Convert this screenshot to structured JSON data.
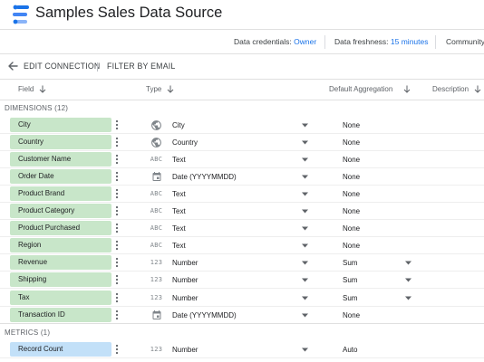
{
  "app": {
    "title": "Samples Sales Data Source"
  },
  "infobar": {
    "credentials_label": "Data credentials:",
    "credentials_value": "Owner",
    "freshness_label": "Data freshness:",
    "freshness_value": "15 minutes",
    "community_label": "Community"
  },
  "actions": {
    "edit_connection": "EDIT CONNECTION",
    "filter_by_email": "FILTER BY EMAIL"
  },
  "columns": {
    "field": "Field",
    "type": "Type",
    "default_aggregation": "Default Aggregation",
    "description": "Description"
  },
  "sections": {
    "dimensions": "DIMENSIONS (12)",
    "metrics": "METRICS (1)"
  },
  "dimensions": [
    {
      "name": "City",
      "icon": "globe-icon",
      "type": "City",
      "aggregation": "None"
    },
    {
      "name": "Country",
      "icon": "globe-icon",
      "type": "Country",
      "aggregation": "None"
    },
    {
      "name": "Customer Name",
      "icon": "text-type-icon",
      "icon_text": "ABC",
      "type": "Text",
      "aggregation": "None"
    },
    {
      "name": "Order Date",
      "icon": "calendar-icon",
      "type": "Date (YYYYMMDD)",
      "aggregation": "None"
    },
    {
      "name": "Product Brand",
      "icon": "text-type-icon",
      "icon_text": "ABC",
      "type": "Text",
      "aggregation": "None"
    },
    {
      "name": "Product Category",
      "icon": "text-type-icon",
      "icon_text": "ABC",
      "type": "Text",
      "aggregation": "None"
    },
    {
      "name": "Product Purchased",
      "icon": "text-type-icon",
      "icon_text": "ABC",
      "type": "Text",
      "aggregation": "None"
    },
    {
      "name": "Region",
      "icon": "text-type-icon",
      "icon_text": "ABC",
      "type": "Text",
      "aggregation": "None"
    },
    {
      "name": "Revenue",
      "icon": "number-type-icon",
      "icon_text": "123",
      "type": "Number",
      "aggregation": "Sum"
    },
    {
      "name": "Shipping",
      "icon": "number-type-icon",
      "icon_text": "123",
      "type": "Number",
      "aggregation": "Sum"
    },
    {
      "name": "Tax",
      "icon": "number-type-icon",
      "icon_text": "123",
      "type": "Number",
      "aggregation": "Sum"
    },
    {
      "name": "Transaction ID",
      "icon": "calendar-icon",
      "type": "Date (YYYYMMDD)",
      "aggregation": "None"
    }
  ],
  "metrics": [
    {
      "name": "Record Count",
      "icon": "number-type-icon",
      "icon_text": "123",
      "type": "Number",
      "aggregation": "Auto"
    }
  ],
  "colors": {
    "dimension_chip": "#c8e6c9",
    "metric_chip": "#c2e0f8",
    "link": "#1a73e8"
  }
}
